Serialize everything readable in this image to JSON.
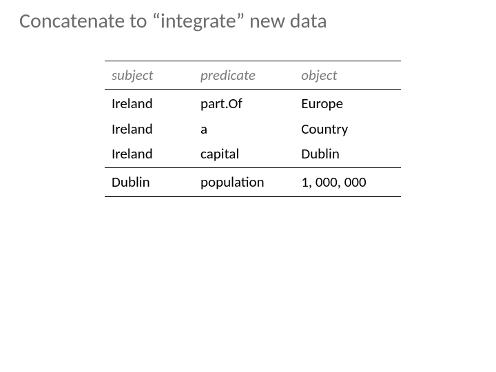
{
  "title": "Concatenate to “integrate” new data",
  "table": {
    "headers": {
      "c1": "subject",
      "c2": "predicate",
      "c3": "object"
    },
    "group1": [
      {
        "c1": "Ireland",
        "c2": "part.Of",
        "c3": "Europe"
      },
      {
        "c1": "Ireland",
        "c2": "a",
        "c3": "Country"
      },
      {
        "c1": "Ireland",
        "c2": "capital",
        "c3": "Dublin"
      }
    ],
    "group2": [
      {
        "c1": "Dublin",
        "c2": "population",
        "c3": "1, 000, 000"
      }
    ]
  }
}
